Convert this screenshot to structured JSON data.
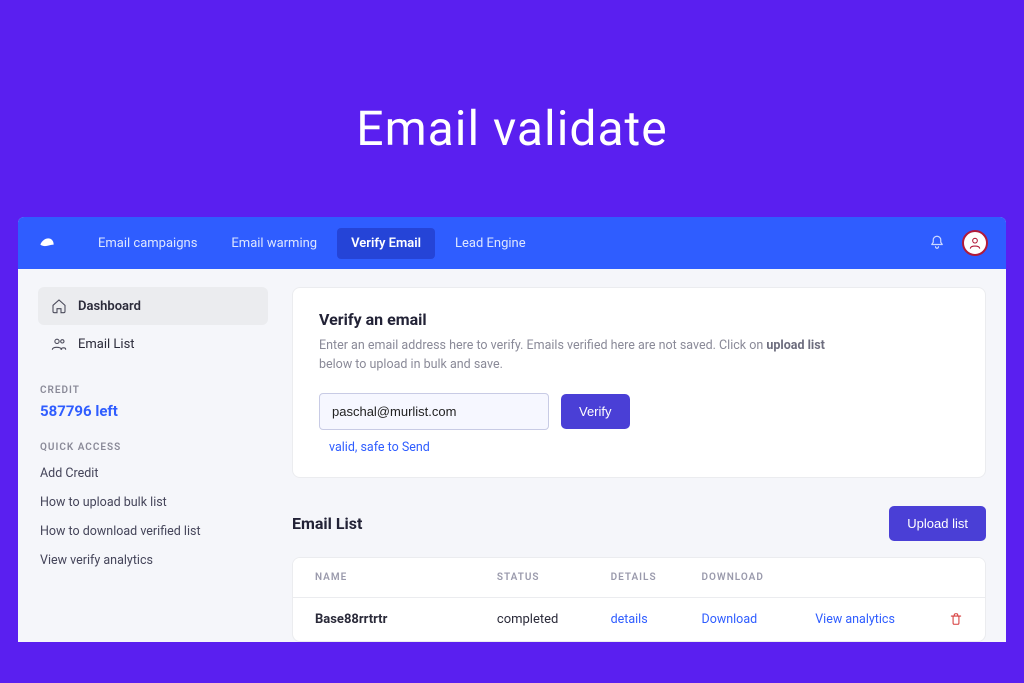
{
  "hero": {
    "title": "Email validate"
  },
  "topnav": {
    "tabs": [
      {
        "label": "Email campaigns"
      },
      {
        "label": "Email warming"
      },
      {
        "label": "Verify Email"
      },
      {
        "label": "Lead Engine"
      }
    ]
  },
  "sidebar": {
    "items": [
      {
        "label": "Dashboard"
      },
      {
        "label": "Email List"
      }
    ],
    "credit_label": "CREDIT",
    "credit_value": "587796 left",
    "quick_label": "QUICK ACCESS",
    "quick_links": [
      {
        "label": "Add Credit"
      },
      {
        "label": "How to upload bulk list"
      },
      {
        "label": "How to download verified list"
      },
      {
        "label": "View verify analytics"
      }
    ]
  },
  "verify_card": {
    "title": "Verify an email",
    "desc_pre": "Enter an email address here to verify. Emails verified here are not saved. Click on ",
    "desc_bold": "upload list",
    "desc_post": " below to upload in bulk and save.",
    "input_value": "paschal@murlist.com",
    "verify_label": "Verify",
    "status": "valid, safe to Send"
  },
  "email_list": {
    "title": "Email List",
    "upload_label": "Upload list",
    "columns": {
      "name": "NAME",
      "status": "STATUS",
      "details": "DETAILS",
      "download": "DOWNLOAD"
    },
    "rows": [
      {
        "name": "Base88rrtrtr",
        "status": "completed",
        "details": "details",
        "download": "Download",
        "analytics": "View analytics"
      }
    ]
  }
}
